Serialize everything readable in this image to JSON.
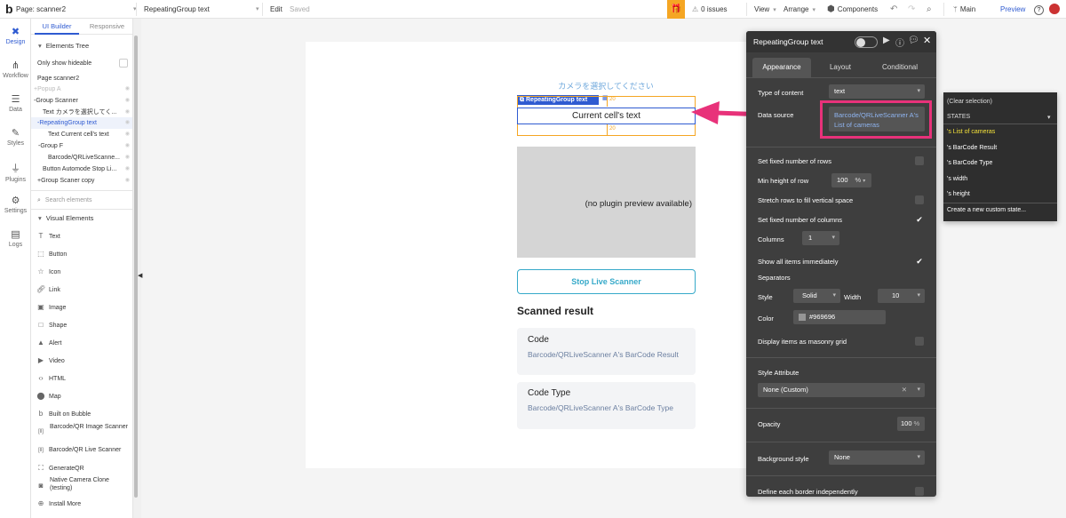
{
  "topbar": {
    "logo": "b",
    "page_label": "Page: scanner2",
    "element_select": "RepeatingGroup text",
    "edit": "Edit",
    "saved": "Saved",
    "issues": "0 issues",
    "view": "View",
    "arrange": "Arrange",
    "components": "Components",
    "branch": "Main",
    "preview": "Preview"
  },
  "rail": {
    "items": [
      {
        "label": "Design",
        "icon": "design-icon"
      },
      {
        "label": "Workflow",
        "icon": "workflow-icon"
      },
      {
        "label": "Data",
        "icon": "data-icon"
      },
      {
        "label": "Styles",
        "icon": "styles-icon"
      },
      {
        "label": "Plugins",
        "icon": "plugins-icon"
      },
      {
        "label": "Settings",
        "icon": "settings-icon"
      },
      {
        "label": "Logs",
        "icon": "logs-icon"
      }
    ]
  },
  "left_panel": {
    "tabs": [
      "UI Builder",
      "Responsive"
    ],
    "elements_tree": "Elements Tree",
    "only_show_hideable": "Only show hideable",
    "tree": [
      {
        "label": "Page scanner2"
      },
      {
        "label": "+Popup A"
      },
      {
        "label": "-Group Scanner"
      },
      {
        "label": "Text カメラを選択してく..."
      },
      {
        "label": "-RepeatingGroup text"
      },
      {
        "label": "Text Current cell's text"
      },
      {
        "label": "-Group F"
      },
      {
        "label": "Barcode/QRLiveScanne..."
      },
      {
        "label": "Button Automode Stop Li..."
      },
      {
        "label": "+Group Scaner copy"
      }
    ],
    "search_placeholder": "Search elements",
    "visual_elements": "Visual Elements",
    "visual_items": [
      {
        "label": "Text",
        "icon": "text-icon"
      },
      {
        "label": "Button",
        "icon": "button-icon"
      },
      {
        "label": "Icon",
        "icon": "star-icon"
      },
      {
        "label": "Link",
        "icon": "link-icon"
      },
      {
        "label": "Image",
        "icon": "image-icon"
      },
      {
        "label": "Shape",
        "icon": "shape-icon"
      },
      {
        "label": "Alert",
        "icon": "alert-icon"
      },
      {
        "label": "Video",
        "icon": "video-icon"
      },
      {
        "label": "HTML",
        "icon": "html-icon"
      },
      {
        "label": "Map",
        "icon": "map-icon"
      },
      {
        "label": "Built on Bubble",
        "icon": "bubble-icon"
      },
      {
        "label": "Barcode/QR Image Scanner",
        "icon": "barcode-icon"
      },
      {
        "label": "Barcode/QR Live Scanner",
        "icon": "barcode-icon"
      },
      {
        "label": "GenerateQR",
        "icon": "qr-icon"
      },
      {
        "label": "Native Camera Clone (testing)",
        "icon": "camera-icon"
      },
      {
        "label": "Install More",
        "icon": "plus-icon"
      }
    ]
  },
  "canvas": {
    "camera_text": "カメラを選択してください",
    "rg_tag": "RepeatingGroup text",
    "cell_text": "Current cell's text",
    "dim_20_a": "20",
    "dim_20_b": "20",
    "plugin_preview": "(no plugin preview available)",
    "stop_button": "Stop Live Scanner",
    "scanned_result": "Scanned result",
    "card1_title": "Code",
    "card1_value": "Barcode/QRLiveScanner A's BarCode Result",
    "card2_title": "Code Type",
    "card2_value": "Barcode/QRLiveScanner A's BarCode Type"
  },
  "props": {
    "title": "RepeatingGroup text",
    "tabs": [
      "Appearance",
      "Layout",
      "Conditional"
    ],
    "type_of_content_label": "Type of content",
    "type_of_content_value": "text",
    "data_source_label": "Data source",
    "data_source_value": "Barcode/QRLiveScanner A's List of cameras",
    "fixed_rows": "Set fixed number of rows",
    "min_height_label": "Min height of row",
    "min_height_value": "100",
    "min_height_unit": "%",
    "stretch_rows": "Stretch rows to fill vertical space",
    "fixed_columns": "Set fixed number of columns",
    "columns_label": "Columns",
    "columns_value": "1",
    "show_all": "Show all items immediately",
    "separators": "Separators",
    "style_label": "Style",
    "style_value": "Solid",
    "width_label": "Width",
    "width_value": "10",
    "color_label": "Color",
    "color_value": "#969696",
    "masonry": "Display items as masonry grid",
    "style_attribute": "Style Attribute",
    "style_attr_value": "None (Custom)",
    "opacity_label": "Opacity",
    "opacity_value": "100",
    "opacity_unit": "%",
    "bg_style_label": "Background style",
    "bg_style_value": "None",
    "border_label": "Define each border independently"
  },
  "states_menu": {
    "clear": "(Clear selection)",
    "header": "STATES",
    "items": [
      "'s List of cameras",
      "'s BarCode Result",
      "'s BarCode Type",
      "'s width",
      "'s height"
    ],
    "create": "Create a new custom state..."
  },
  "colors": {
    "accent": "#2f5bd1",
    "highlight": "#e8327a",
    "state_selected": "#f5e23a",
    "cyan": "#36a9c9",
    "separator_color": "#969696",
    "orange": "#f5a623"
  }
}
